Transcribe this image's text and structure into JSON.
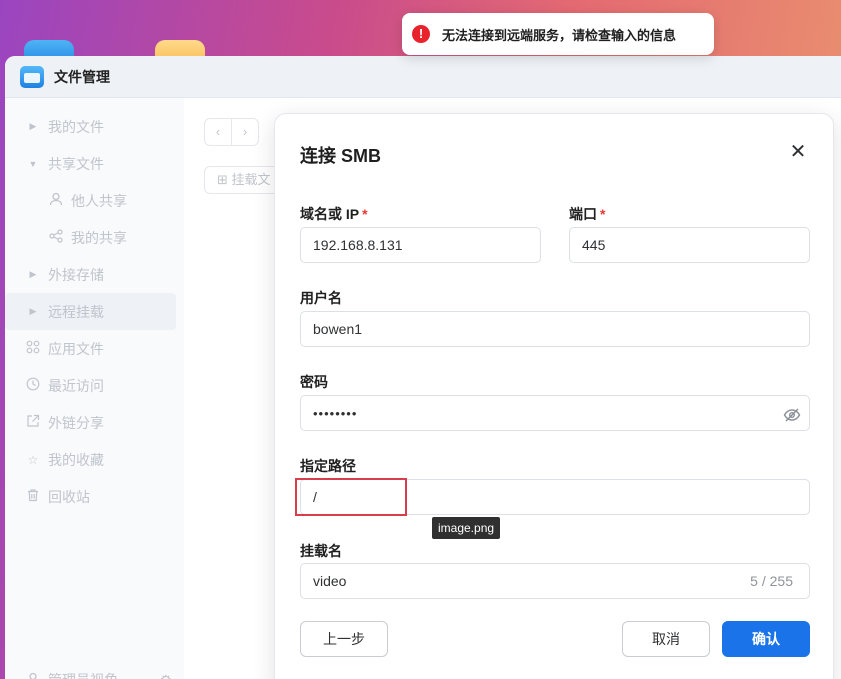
{
  "app": {
    "title": "文件管理"
  },
  "sidebar": {
    "items": [
      {
        "label": "我的文件",
        "icon": "caret-right-icon"
      },
      {
        "label": "共享文件",
        "icon": "caret-down-icon"
      },
      {
        "label": "他人共享",
        "icon": "user-icon"
      },
      {
        "label": "我的共享",
        "icon": "share-icon"
      },
      {
        "label": "外接存储",
        "icon": "caret-right-icon"
      },
      {
        "label": "远程挂载",
        "icon": "caret-right-icon"
      },
      {
        "label": "应用文件",
        "icon": "apps-icon"
      },
      {
        "label": "最近访问",
        "icon": "clock-icon"
      },
      {
        "label": "外链分享",
        "icon": "link-share-icon"
      },
      {
        "label": "我的收藏",
        "icon": "star-icon"
      },
      {
        "label": "回收站",
        "icon": "trash-icon"
      }
    ],
    "footer": "管理员视角"
  },
  "toolbar": {
    "mount_button": "挂载文"
  },
  "dialog": {
    "title": "连接 SMB",
    "close": "✕",
    "host_label": "域名或 IP",
    "host_value": "192.168.8.131",
    "port_label": "端口",
    "port_value": "445",
    "required_mark": "*",
    "username_label": "用户名",
    "username_value": "bowen1",
    "password_label": "密码",
    "password_value": "••••••••",
    "path_label": "指定路径",
    "path_value": "/",
    "mount_name_label": "挂载名",
    "mount_name_value": "video",
    "mount_name_counter": "5 / 255",
    "prev_button": "上一步",
    "cancel_button": "取消",
    "confirm_button": "确认"
  },
  "tooltip": "image.png",
  "toast": {
    "icon": "!",
    "message": "无法连接到远端服务，请检查输入的信息"
  },
  "colors": {
    "primary": "#1a73e8",
    "error": "#e8232c",
    "annotation": "#d93c4a"
  }
}
